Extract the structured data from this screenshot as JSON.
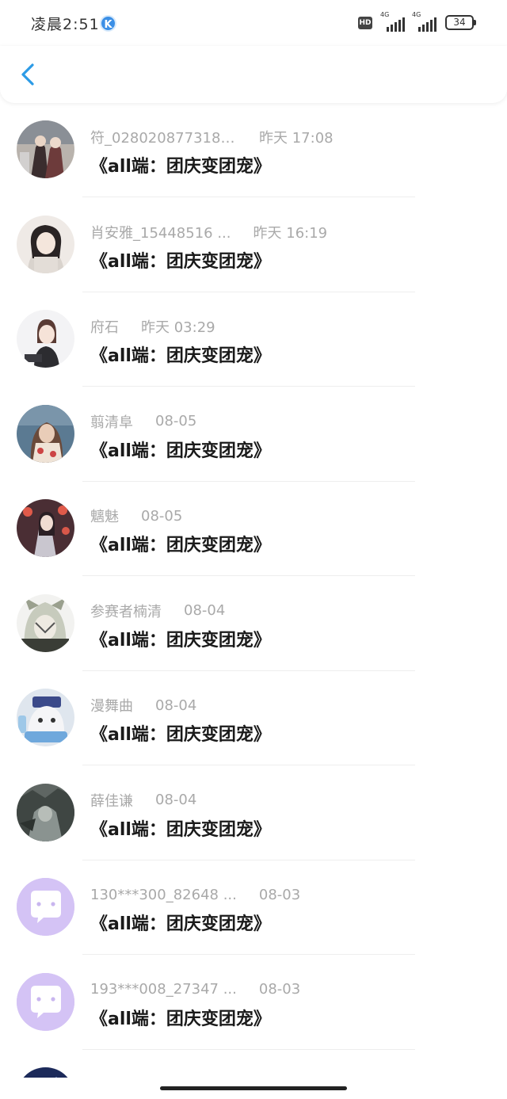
{
  "status_bar": {
    "time": "凌晨2:51",
    "app_badge": "K",
    "hd": "HD",
    "network1": "4G",
    "network2": "4G",
    "battery": "34"
  },
  "colors": {
    "accent": "#2c9be6",
    "default_avatar": "#d4c3f5",
    "meta_text": "#a9a9a9"
  },
  "items": [
    {
      "name": "符_028020877318 ...",
      "time": "昨天 17:08",
      "title": "《all端：团庆变团宠》",
      "avatar": "photo"
    },
    {
      "name": "肖安雅_15448516 ...",
      "time": "昨天 16:19",
      "title": "《all端：团庆变团宠》",
      "avatar": "photo"
    },
    {
      "name": "府石",
      "time": "昨天 03:29",
      "title": "《all端：团庆变团宠》",
      "avatar": "photo"
    },
    {
      "name": "翦清阜",
      "time": "08-05",
      "title": "《all端：团庆变团宠》",
      "avatar": "photo"
    },
    {
      "name": "魑魅",
      "time": "08-05",
      "title": "《all端：团庆变团宠》",
      "avatar": "photo"
    },
    {
      "name": "参赛者楠清",
      "time": "08-04",
      "title": "《all端：团庆变团宠》",
      "avatar": "photo"
    },
    {
      "name": "漫舞曲",
      "time": "08-04",
      "title": "《all端：团庆变团宠》",
      "avatar": "photo"
    },
    {
      "name": "薛佳谦",
      "time": "08-04",
      "title": "《all端：团庆变团宠》",
      "avatar": "photo"
    },
    {
      "name": "130***300_82648 ...",
      "time": "08-03",
      "title": "《all端：团庆变团宠》",
      "avatar": "default"
    },
    {
      "name": "193***008_27347 ...",
      "time": "08-03",
      "title": "《all端：团庆变团宠》",
      "avatar": "default"
    },
    {
      "name": "",
      "time": "",
      "title": "",
      "avatar": "photo"
    }
  ]
}
